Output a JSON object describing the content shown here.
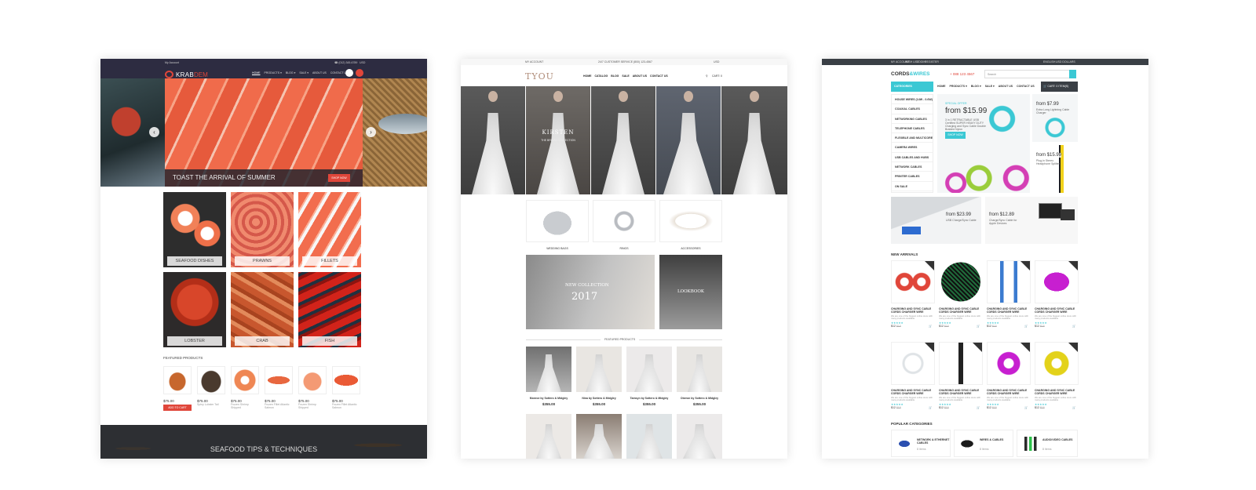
{
  "krab": {
    "topbar": {
      "left": "My Account",
      "phone": "(012) 345-6789",
      "currency": "USD"
    },
    "logo": {
      "part1": "KRAB",
      "part2": "DEM"
    },
    "nav": [
      "HOME",
      "PRODUCTS ▾",
      "BLOG ▾",
      "SALE ▾",
      "ABOUT US",
      "CONTACT US"
    ],
    "search_placeholder": "Search",
    "hero_caption": "TOAST THE ARRIVAL OF SUMMER",
    "hero_button": "SHOP NOW",
    "categories": [
      "SEAFOOD DISHES",
      "PRAWNS",
      "FILLETS",
      "LOBSTER",
      "CRAB",
      "FISH"
    ],
    "featured_title": "FEATURED PRODUCTS",
    "products": [
      {
        "price": "$75.00",
        "desc": ""
      },
      {
        "price": "$75.00",
        "desc": "Spiny Lobster Tail"
      },
      {
        "price": "$75.00",
        "desc": "Frozen Shrimp Shipped"
      },
      {
        "price": "$75.00",
        "desc": "Frozen Fillet Atlantic Salmon"
      },
      {
        "price": "$75.00",
        "desc": "Frozen Shrimp Shipped"
      },
      {
        "price": "$75.00",
        "desc": "Frozen Fillet Atlantic Salmon"
      }
    ],
    "add_to_cart": "ADD TO CART",
    "banner": "SEAFOOD TIPS & TECHNIQUES"
  },
  "tyou": {
    "topbar": {
      "left": "MY ACCOUNT",
      "center": "24/7 CUSTOMER SERVICE (800) 123-4567",
      "right": "USD"
    },
    "logo": "TYOU",
    "nav": [
      "HOME",
      "CATALOG",
      "BLOG",
      "SALE",
      "ABOUT US",
      "CONTACT US"
    ],
    "cart": "CART: 0",
    "hero_title": "KIRSTEN",
    "hero_sub": "THE BRIDAL COLLECTION",
    "accessories": [
      "WEDDING BAGS",
      "RINGS",
      "ACCESSORIES"
    ],
    "promo1_line1": "NEW COLLECTION",
    "promo1_line2": "2017",
    "promo2": "LOOKBOOK",
    "featured_title": "FEATURED PRODUCTS",
    "products": [
      {
        "name": "Monroe by Sottero & Midgley",
        "price": "$355.00"
      },
      {
        "name": "Nina by Sottero & Midgley",
        "price": "$355.00"
      },
      {
        "name": "Tamsyn by Sottero & Midgley",
        "price": "$355.00"
      },
      {
        "name": "Oberon by Sottero & Midgley",
        "price": "$355.00"
      }
    ]
  },
  "cords": {
    "topbar": {
      "links": [
        "MY ACCOUNT",
        "WISH LIST",
        "LOGIN",
        "REGISTER"
      ],
      "right": [
        "ENGLISH",
        "USD DOLLARS"
      ]
    },
    "logo": {
      "part1": "CORDS",
      "part2": "&WIRES"
    },
    "phone": "+ 088 123 4567",
    "search_placeholder": "Search",
    "categories_title": "CATEGORIES",
    "nav": [
      "HOME",
      "PRODUCTS ▾",
      "BLOG ▾",
      "SALE ▾",
      "ABOUT US",
      "CONTACT US"
    ],
    "cart": "CART: 0 ITEM(S)",
    "categories": [
      "HOUSE WIRES (14W - 0.6W)",
      "COAXIAL CABLES",
      "NETWORKING CABLES",
      "TELEPHONE CABLES",
      "FLEXIBLE AND MULTICORE",
      "CAMERA WIRES",
      "USB CABLES AND HUBS",
      "NETWORK CABLES",
      "PRINTER CABLES",
      "ON SALE"
    ],
    "hero": {
      "eyebrow": "SPECIAL OFFER",
      "price": "from $15.99",
      "desc": "3 in 1 RETRACTABLE USB Certified SUPER HEAVY DUTY Charging and Sync Cable Double Braided Nylon",
      "button": "SHOP NOW"
    },
    "side1": {
      "price": "from $7.99",
      "desc": "Extra Long Lightning Cable Charger"
    },
    "side2": {
      "price": "from $15.99",
      "desc": "Plug-in Stereo Headphone Splitter"
    },
    "banner1": {
      "price": "from $23.99",
      "desc": "USB Charge/Sync Cable"
    },
    "banner2": {
      "price": "from $12.89",
      "desc": "Charge/Sync Cable for Apple Devices"
    },
    "new_arrivals": "NEW ARRIVALS",
    "product_name": "CHARGING AND SYNC CABLE CORDS CHARGER WIRE",
    "product_desc": "We are one of the biggest online store with many products available",
    "product_price": "$12",
    "product_old": "$15",
    "popular_title": "POPULAR CATEGORIES",
    "popular": [
      {
        "name": "NETWORK & ETHERNET CABLES",
        "count": "8 Items"
      },
      {
        "name": "WIRES & CABLES",
        "count": "8 Items"
      },
      {
        "name": "AUDIO/VIDEO CABLES",
        "count": "8 Items"
      }
    ]
  }
}
